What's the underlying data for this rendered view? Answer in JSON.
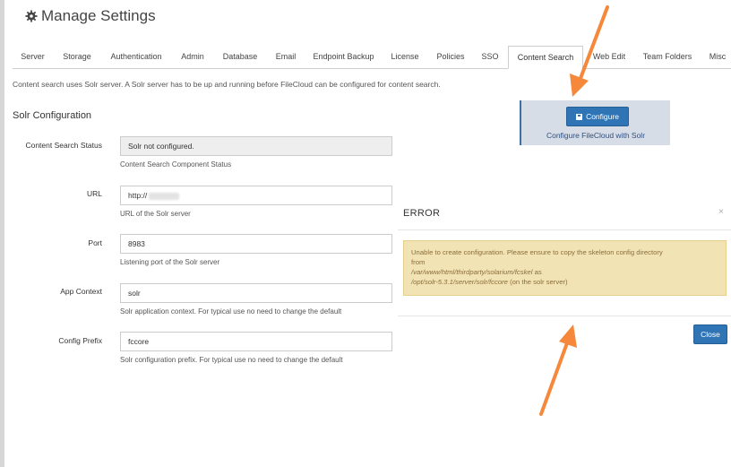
{
  "header": {
    "title": "Manage Settings",
    "icon": "gear-icon"
  },
  "tabs": [
    {
      "label": "Server"
    },
    {
      "label": "Storage"
    },
    {
      "label": "Authentication"
    },
    {
      "label": "Admin"
    },
    {
      "label": "Database"
    },
    {
      "label": "Email"
    },
    {
      "label": "Endpoint Backup"
    },
    {
      "label": "License"
    },
    {
      "label": "Policies"
    },
    {
      "label": "SSO"
    },
    {
      "label": "Content Search",
      "active": true
    },
    {
      "label": "Web Edit"
    },
    {
      "label": "Team Folders"
    },
    {
      "label": "Misc"
    }
  ],
  "info_text": "Content search uses Solr server. A Solr server has to be up and running before FileCloud can be configured for content search.",
  "section_title": "Solr Configuration",
  "form": {
    "status": {
      "label": "Content Search Status",
      "value": "Solr not configured.",
      "help": "Content Search Component Status"
    },
    "url": {
      "label": "URL",
      "value": "http://",
      "help": "URL of the Solr server"
    },
    "port": {
      "label": "Port",
      "value": "8983",
      "help": "Listening port of the Solr server"
    },
    "app_context": {
      "label": "App Context",
      "value": "solr",
      "help": "Solr application context. For typical use no need to change the default"
    },
    "config_prefix": {
      "label": "Config Prefix",
      "value": "fccore",
      "help": "Solr configuration prefix. For typical use no need to change the default"
    }
  },
  "configure_panel": {
    "button_label": "Configure",
    "caption": "Configure FileCloud with Solr"
  },
  "modal": {
    "title": "ERROR",
    "close_x": "×",
    "message_line1": "Unable to create configuration. Please ensure to copy the skeleton config directory",
    "message_line2": "from",
    "path_from": "/var/www/html/thirdparty/solarium/fcskel",
    "as_word": "as",
    "path_to": "/opt/solr-5.3.1/server/solr/fccore",
    "suffix": "(on the solr server)",
    "close_button": "Close"
  },
  "colors": {
    "accent": "#2f74b5",
    "arrow": "#f5883a",
    "alert_bg": "#f2e3b4",
    "alert_text": "#8a6d3b"
  }
}
